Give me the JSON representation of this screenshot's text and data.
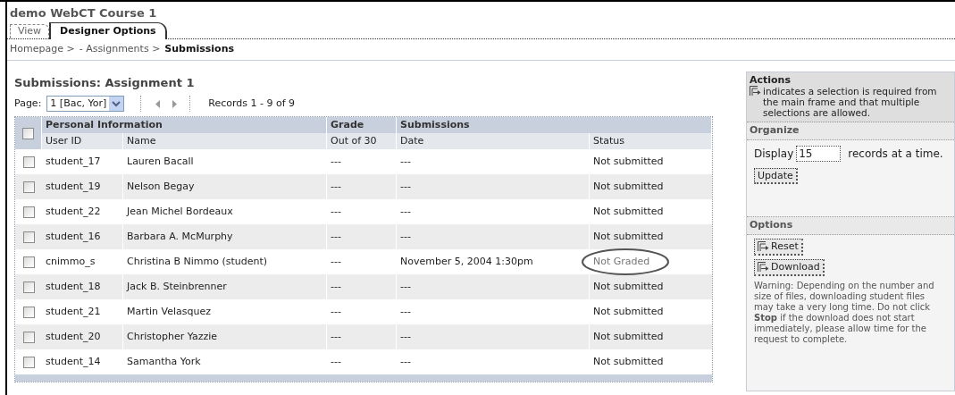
{
  "course_title": "demo WebCT Course 1",
  "tabs": [
    {
      "label": "View",
      "selected": false
    },
    {
      "label": "Designer Options",
      "selected": true
    }
  ],
  "breadcrumb": [
    {
      "label": "Homepage >",
      "current": false
    },
    {
      "label": "- Assignments >",
      "current": false
    },
    {
      "label": "Submissions",
      "current": true
    }
  ],
  "heading": "Submissions: Assignment 1",
  "pager": {
    "label": "Page:",
    "value": "1 [Bac, Yor]",
    "records": "Records 1 - 9 of 9"
  },
  "table": {
    "group_columns": [
      "Personal Information",
      "Grade",
      "Submissions"
    ],
    "columns": [
      "User ID",
      "Name",
      "Out of 30",
      "Date",
      "Status"
    ],
    "select_all": {
      "checked": false
    },
    "rows": [
      {
        "user_id": "student_17",
        "name": "Lauren Bacall",
        "grade": "---",
        "date": "---",
        "status": "Not submitted",
        "checked": false,
        "circled": false
      },
      {
        "user_id": "student_19",
        "name": "Nelson Begay",
        "grade": "---",
        "date": "---",
        "status": "Not submitted",
        "checked": false,
        "circled": false
      },
      {
        "user_id": "student_22",
        "name": "Jean Michel Bordeaux",
        "grade": "---",
        "date": "---",
        "status": "Not submitted",
        "checked": false,
        "circled": false
      },
      {
        "user_id": "student_16",
        "name": "Barbara A. McMurphy",
        "grade": "---",
        "date": "---",
        "status": "Not submitted",
        "checked": false,
        "circled": false
      },
      {
        "user_id": "cnimmo_s",
        "name": "Christina B Nimmo (student)",
        "grade": "---",
        "date": "November 5, 2004 1:30pm",
        "status": "Not Graded",
        "checked": false,
        "circled": true
      },
      {
        "user_id": "student_18",
        "name": "Jack B. Steinbrenner",
        "grade": "---",
        "date": "---",
        "status": "Not submitted",
        "checked": false,
        "circled": false
      },
      {
        "user_id": "student_21",
        "name": "Martin Velasquez",
        "grade": "---",
        "date": "---",
        "status": "Not submitted",
        "checked": false,
        "circled": false
      },
      {
        "user_id": "student_20",
        "name": "Christopher Yazzie",
        "grade": "---",
        "date": "---",
        "status": "Not submitted",
        "checked": false,
        "circled": false
      },
      {
        "user_id": "student_14",
        "name": "Samantha York",
        "grade": "---",
        "date": "---",
        "status": "Not submitted",
        "checked": false,
        "circled": false
      }
    ]
  },
  "actions": {
    "title": "Actions",
    "note": "indicates a selection is required from the main frame and that multiple selections are allowed."
  },
  "organize": {
    "title": "Organize",
    "label": "Display",
    "value": "15",
    "suffix": "records at a time.",
    "button": "Update"
  },
  "options": {
    "title": "Options",
    "buttons": [
      "Reset",
      "Download"
    ],
    "warning": "Warning: Depending on the number and size of files, downloading student files may take a very long time. Do not click **Stop** if the download does not start immediately, please allow time for the request to complete."
  }
}
